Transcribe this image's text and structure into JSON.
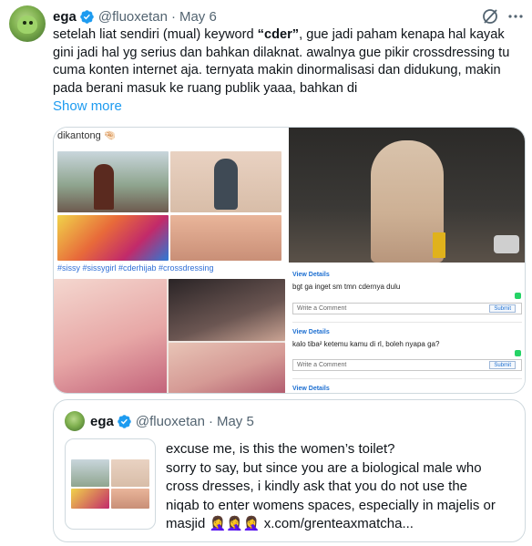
{
  "tweet": {
    "author_name": "ega",
    "handle": "@fluoxetan",
    "separator": "·",
    "date": "May 6",
    "text_parts": [
      "setelah liat sendiri (mual) keyword ",
      "“cder”",
      ", gue jadi paham kenapa hal kayak gini jadi hal yg serius dan bahkan dilaknat. awalnya gue pikir crossdressing tu cuma konten internet aja. ternyata makin dinormalisasi dan didukung, makin pada berani masuk ke ruang publik yaaa, bahkan di"
    ],
    "show_more": "Show more",
    "icons": {
      "verified": "verified-badge-icon",
      "grok": "grok-icon",
      "more": "more-options-icon"
    },
    "media": {
      "left_caption": "dikantong 🤏🏻",
      "hashtags": "#sissy #sissygirl #cderhijab #crossdressing",
      "comments": [
        {
          "link": "View Details",
          "text": "bgt ga inget sm tmn cdernya dulu",
          "placeholder": "Write a Comment",
          "button": "Submit"
        },
        {
          "link": "View Details",
          "text": "kalo tiba² ketemu kamu di rl, boleh nyapa ga?",
          "placeholder": "Write a Comment",
          "button": "Submit"
        },
        {
          "link": "View Details"
        }
      ]
    }
  },
  "quote": {
    "author_name": "ega",
    "handle": "@fluoxetan",
    "separator": "·",
    "date": "May 5",
    "lines": [
      "excuse me, is this the women’s toilet?",
      "sorry to say, but since you are a biological male who",
      "cross dresses, i kindly ask that you do not use the",
      "niqab to enter womens spaces, especially in majelis or",
      "masjid 🤦‍♀️🤦‍♀️🤦‍♀️ x.com/grenteaxmatcha..."
    ]
  },
  "colors": {
    "accent": "#1d9bf0",
    "text": "#0f1419",
    "muted": "#536471",
    "border": "#cfd9de"
  }
}
